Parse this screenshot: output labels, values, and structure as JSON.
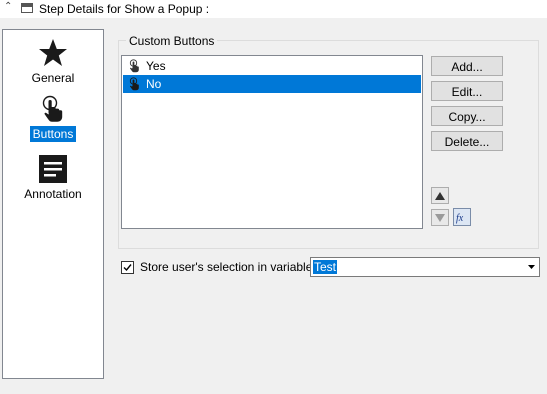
{
  "header": {
    "title": "Step Details for Show a Popup :",
    "collapse_icon": "chevron-up-icon",
    "window_icon": "window-icon"
  },
  "sidebar": {
    "items": [
      {
        "label": "General",
        "icon": "star-icon",
        "selected": false
      },
      {
        "label": "Buttons",
        "icon": "hand-pointer-icon",
        "selected": true
      },
      {
        "label": "Annotation",
        "icon": "document-text-icon",
        "selected": false
      }
    ]
  },
  "custom_buttons": {
    "title": "Custom Buttons",
    "list": [
      {
        "label": "Yes",
        "icon": "hand-pointer-icon",
        "selected": false
      },
      {
        "label": "No",
        "icon": "hand-pointer-icon",
        "selected": true
      }
    ],
    "actions": {
      "add": "Add...",
      "edit": "Edit...",
      "copy": "Copy...",
      "delete": "Delete..."
    },
    "move_up_icon": "triangle-up-icon",
    "move_down_icon": "triangle-down-icon",
    "formula_icon": "fx-icon"
  },
  "store_selection": {
    "checked": true,
    "label": "Store user's selection in variable:",
    "value": "Test"
  },
  "colors": {
    "selection": "#0078d7",
    "background": "#f0f0f0",
    "border": "#828790"
  }
}
